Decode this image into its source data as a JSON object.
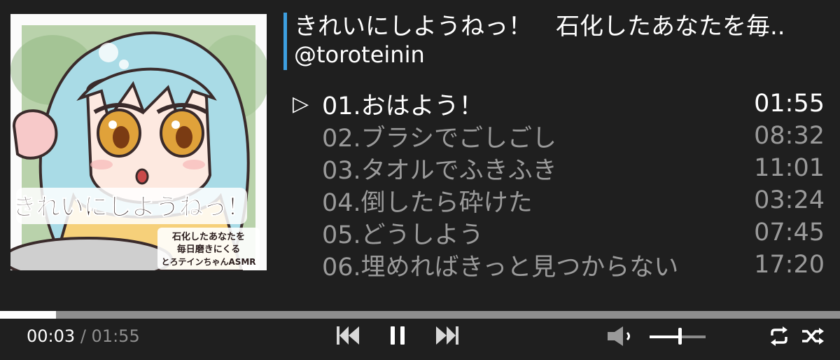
{
  "album": {
    "title": "きれいにしようねっ！　石化したあなたを毎..",
    "artist": "@toroteinin",
    "cover": {
      "headline": "きれいにしようねっ！",
      "sub_lines": [
        "石化したあなたを",
        "毎日磨きにくる",
        "とろテインちゃんASMR"
      ]
    }
  },
  "tracks": [
    {
      "label": "01.おはよう！",
      "duration": "01:55",
      "active": true
    },
    {
      "label": "02.ブラシでごしごし",
      "duration": "08:32",
      "active": false
    },
    {
      "label": "03.タオルでふきふき",
      "duration": "11:01",
      "active": false
    },
    {
      "label": "04.倒したら砕けた",
      "duration": "03:24",
      "active": false
    },
    {
      "label": "05.どうしよう",
      "duration": "07:45",
      "active": false
    },
    {
      "label": "06.埋めればきっと見つからない",
      "duration": "17:20",
      "active": false
    }
  ],
  "player": {
    "current_time": "00:03",
    "separator": "/",
    "total_time": "01:55",
    "progress": 0.067,
    "volume": 0.56,
    "play_marker": "▷"
  },
  "icons": {
    "previous": "skip-previous-icon",
    "pause": "pause-icon",
    "next": "skip-next-icon",
    "volume": "volume-icon",
    "repeat": "repeat-icon",
    "shuffle": "shuffle-icon"
  },
  "colors": {
    "background": "#1f1f1f",
    "accent": "#3d9fe0",
    "inactive_text": "#9a9a9a"
  }
}
